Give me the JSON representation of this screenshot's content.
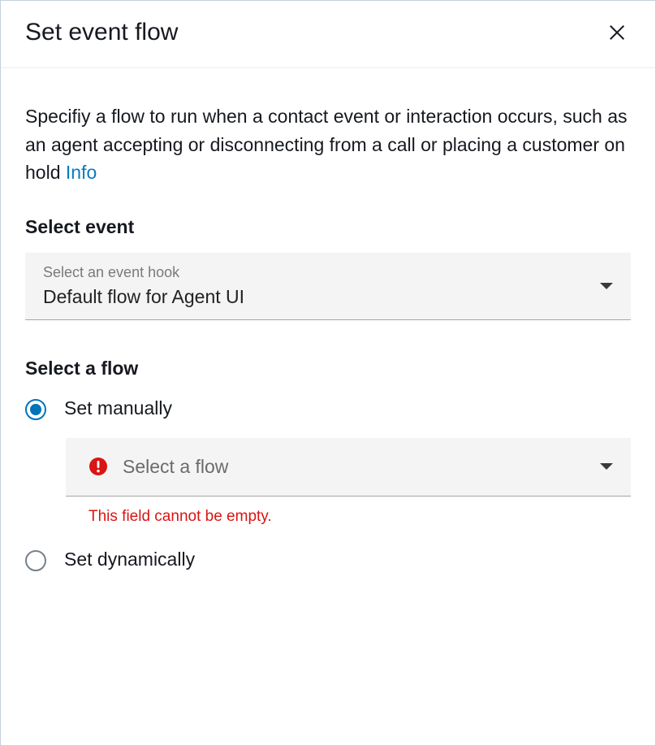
{
  "header": {
    "title": "Set event flow"
  },
  "description": {
    "text": "Specifiy a flow to run when a contact event or interaction occurs, such as an agent accepting or disconnecting from a call or placing a customer on hold ",
    "info_label": "Info"
  },
  "event_section": {
    "label": "Select event",
    "dropdown": {
      "mini_label": "Select an event hook",
      "value": "Default flow for Agent UI"
    }
  },
  "flow_section": {
    "label": "Select a flow",
    "options": {
      "manual_label": "Set manually",
      "dynamic_label": "Set dynamically"
    },
    "flow_dropdown": {
      "placeholder": "Select a flow",
      "error": "This field cannot be empty."
    }
  }
}
